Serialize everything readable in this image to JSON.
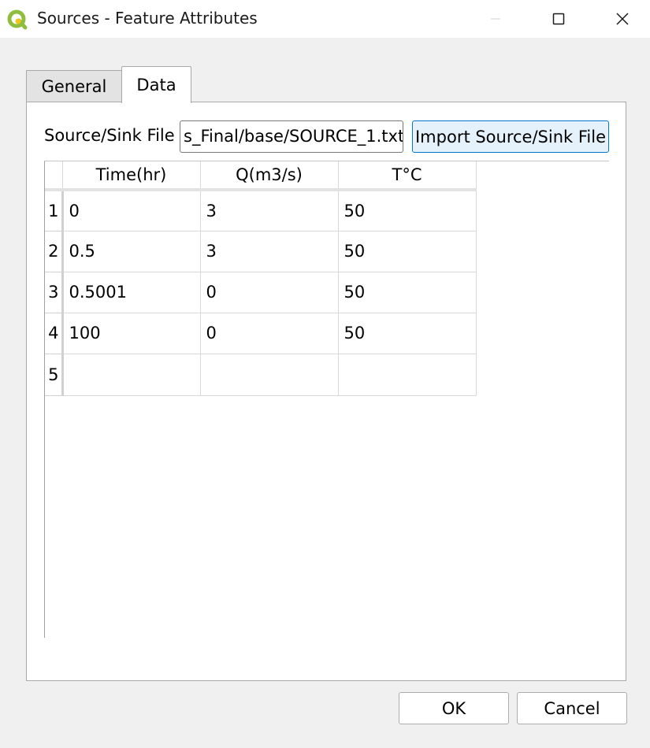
{
  "window": {
    "title": "Sources - Feature Attributes",
    "app_icon": "qgis-logo-icon",
    "controls": [
      "minimize-icon",
      "maximize-icon",
      "close-icon"
    ]
  },
  "tabs": [
    {
      "label": "General",
      "selected": false
    },
    {
      "label": "Data",
      "selected": true
    }
  ],
  "source_sink": {
    "label": "Source/Sink File",
    "file_value": "s_Final/base/SOURCE_1.txt",
    "import_button": "Import Source/Sink File"
  },
  "table": {
    "columns": [
      "Time(hr)",
      "Q(m3/s)",
      "T°C"
    ],
    "rows": [
      {
        "num": "1",
        "cells": [
          "0",
          "3",
          "50"
        ]
      },
      {
        "num": "2",
        "cells": [
          "0.5",
          "3",
          "50"
        ]
      },
      {
        "num": "3",
        "cells": [
          "0.5001",
          "0",
          "50"
        ]
      },
      {
        "num": "4",
        "cells": [
          "100",
          "0",
          "50"
        ]
      },
      {
        "num": "5",
        "cells": [
          "",
          "",
          ""
        ]
      }
    ]
  },
  "buttons": {
    "ok": "OK",
    "cancel": "Cancel"
  },
  "colors": {
    "accent": "#0078d4",
    "qgis_green": "#8fbe3f",
    "qgis_yellow": "#f0c419"
  }
}
